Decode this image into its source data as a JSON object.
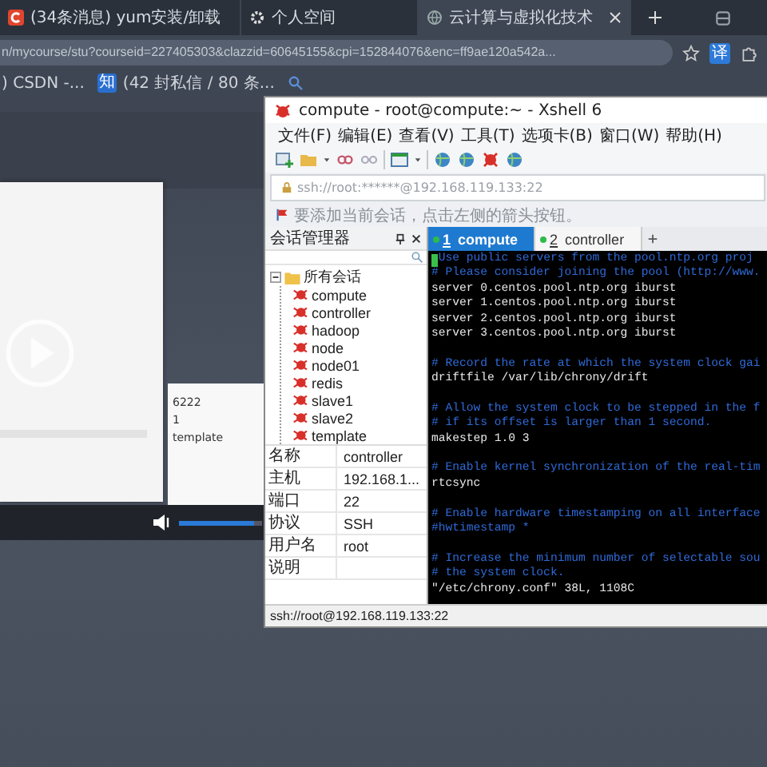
{
  "browser": {
    "tabs": [
      {
        "label": "(34条消息) yum安装/卸载",
        "selected": false
      },
      {
        "label": "个人空间",
        "selected": false
      },
      {
        "label": "云计算与虚拟化技术",
        "selected": true
      }
    ],
    "address": "n/mycourse/stu?courseid=227405303&clazzid=60645155&cpi=152844076&enc=ff9ae120a542a...",
    "translate_badge": "译",
    "bookmarks": [
      {
        "label": ") CSDN -..."
      },
      {
        "label": "(42 封私信 / 80 条...",
        "badge": "知"
      }
    ]
  },
  "background_page": {
    "panel_items": [
      {
        "text": "6222"
      },
      {
        "text": "1"
      },
      {
        "text": "template"
      }
    ],
    "volume": {
      "level": 0.9
    }
  },
  "xshell": {
    "title": "compute - root@compute:~ - Xshell 6",
    "menu": [
      "文件(F)",
      "编辑(E)",
      "查看(V)",
      "工具(T)",
      "选项卡(B)",
      "窗口(W)",
      "帮助(H)"
    ],
    "address": "ssh://root:******@192.168.119.133:22",
    "hint": "要添加当前会话，点击左侧的箭头按钮。",
    "session_manager": {
      "title": "会话管理器",
      "tree": [
        {
          "label": "所有会话",
          "expanded": true,
          "children": [
            {
              "label": "compute"
            },
            {
              "label": "controller"
            },
            {
              "label": "hadoop"
            },
            {
              "label": "node"
            },
            {
              "label": "node01"
            },
            {
              "label": "redis"
            },
            {
              "label": "slave1"
            },
            {
              "label": "slave2"
            },
            {
              "label": "template"
            }
          ]
        }
      ],
      "properties": [
        {
          "name": "名称",
          "value": "controller"
        },
        {
          "name": "主机",
          "value": "192.168.1..."
        },
        {
          "name": "端口",
          "value": "22"
        },
        {
          "name": "协议",
          "value": "SSH"
        },
        {
          "name": "用户名",
          "value": "root"
        },
        {
          "name": "说明"
        }
      ]
    },
    "terminal": {
      "tabs": [
        {
          "number": "1",
          "label": "compute",
          "selected": true
        },
        {
          "number": "2",
          "label": "controller",
          "selected": false
        }
      ],
      "lines": [
        {
          "kind": "cursor",
          "text": "Use public servers from the pool.ntp.org proj"
        },
        {
          "kind": "comment",
          "text": "# Please consider joining the pool (http://www."
        },
        {
          "kind": "text",
          "text": "server 0.centos.pool.ntp.org iburst"
        },
        {
          "kind": "text",
          "text": "server 1.centos.pool.ntp.org iburst"
        },
        {
          "kind": "text",
          "text": "server 2.centos.pool.ntp.org iburst"
        },
        {
          "kind": "text",
          "text": "server 3.centos.pool.ntp.org iburst"
        },
        {
          "kind": "blank"
        },
        {
          "kind": "comment",
          "text": "# Record the rate at which the system clock gai"
        },
        {
          "kind": "text",
          "text": "driftfile /var/lib/chrony/drift"
        },
        {
          "kind": "blank"
        },
        {
          "kind": "comment",
          "text": "# Allow the system clock to be stepped in the f"
        },
        {
          "kind": "comment",
          "text": "# if its offset is larger than 1 second."
        },
        {
          "kind": "text",
          "text": "makestep 1.0 3"
        },
        {
          "kind": "blank"
        },
        {
          "kind": "comment",
          "text": "# Enable kernel synchronization of the real-tim"
        },
        {
          "kind": "text",
          "text": "rtcsync"
        },
        {
          "kind": "blank"
        },
        {
          "kind": "comment",
          "text": "# Enable hardware timestamping on all interface"
        },
        {
          "kind": "comment",
          "text": "#hwtimestamp *"
        },
        {
          "kind": "blank"
        },
        {
          "kind": "comment",
          "text": "# Increase the minimum number of selectable sou"
        },
        {
          "kind": "comment",
          "text": "# the system clock."
        },
        {
          "kind": "text",
          "text": "\"/etc/chrony.conf\" 38L, 1108C"
        }
      ]
    },
    "status": "ssh://root@192.168.119.133:22"
  }
}
